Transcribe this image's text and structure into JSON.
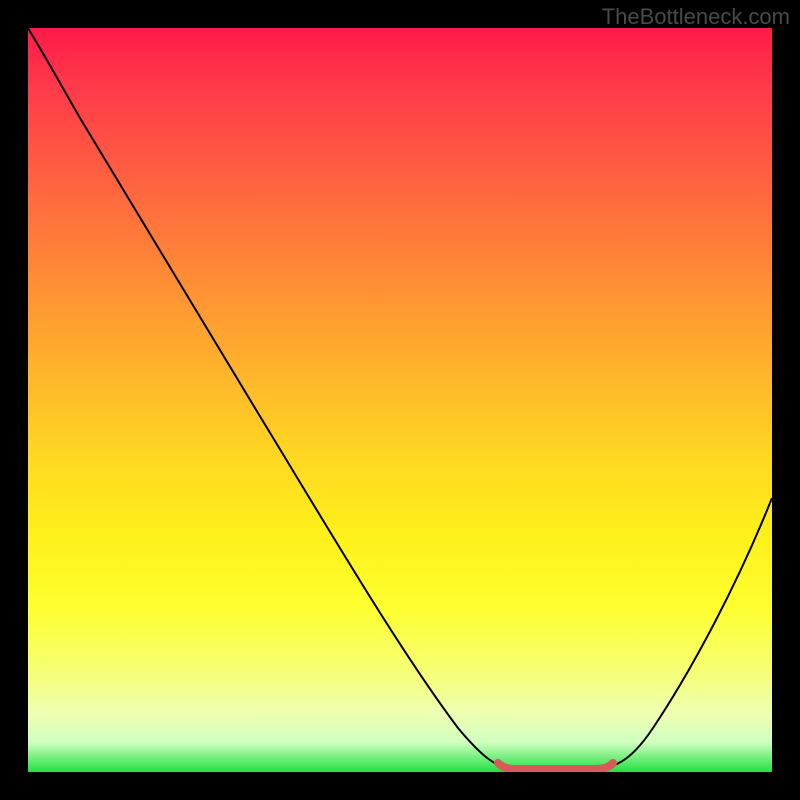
{
  "watermark": "TheBottleneck.com",
  "chart_data": {
    "type": "line",
    "title": "",
    "xlabel": "",
    "ylabel": "",
    "x": [
      0.0,
      0.05,
      0.1,
      0.15,
      0.2,
      0.25,
      0.3,
      0.35,
      0.4,
      0.45,
      0.5,
      0.55,
      0.6,
      0.65,
      0.7,
      0.75,
      0.8,
      0.85,
      0.9,
      0.95,
      1.0
    ],
    "values": [
      1.0,
      0.94,
      0.87,
      0.78,
      0.7,
      0.61,
      0.53,
      0.44,
      0.36,
      0.27,
      0.19,
      0.11,
      0.05,
      0.01,
      0.0,
      0.0,
      0.02,
      0.08,
      0.16,
      0.26,
      0.37
    ],
    "ylim": [
      0,
      1
    ],
    "xlim": [
      0,
      1
    ],
    "flat_region_x": [
      0.62,
      0.78
    ],
    "colors": {
      "gradient_top": "#ff1a4a",
      "gradient_bottom": "#21e040",
      "curve": "#000000",
      "flat_highlight": "#d85a5a",
      "background": "#000000"
    }
  }
}
